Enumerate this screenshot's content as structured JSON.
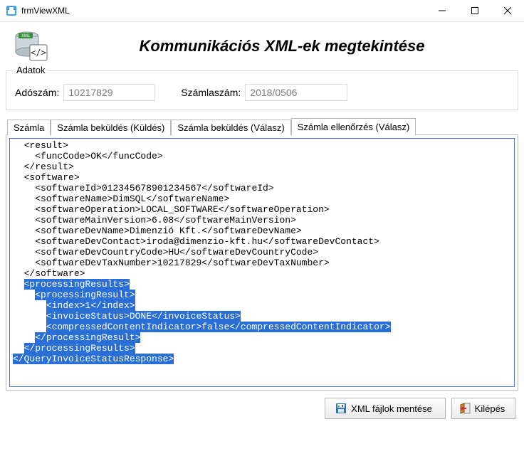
{
  "window": {
    "title": "frmViewXML"
  },
  "header": {
    "title": "Kommunikációs XML-ek megtekintése"
  },
  "adatok": {
    "legend": "Adatok",
    "tax_label": "Adószám:",
    "tax_value": "10217829",
    "invoice_label": "Számlaszám:",
    "invoice_value": "2018/0506"
  },
  "tabs": {
    "items": [
      {
        "label": "Számla"
      },
      {
        "label": "Számla beküldés (Küldés)"
      },
      {
        "label": "Számla beküldés (Válasz)"
      },
      {
        "label": "Számla ellenőrzés (Válasz)"
      }
    ],
    "active_index": 3
  },
  "xml": {
    "plain": "  <result>\n    <funcCode>OK</funcCode>\n  </result>\n  <software>\n    <softwareId>012345678901234567</softwareId>\n    <softwareName>DimSQL</softwareName>\n    <softwareOperation>LOCAL_SOFTWARE</softwareOperation>\n    <softwareMainVersion>6.08</softwareMainVersion>\n    <softwareDevName>Dimenzió Kft.</softwareDevName>\n    <softwareDevContact>iroda@dimenzio-kft.hu</softwareDevContact>\n    <softwareDevCountryCode>HU</softwareDevCountryCode>\n    <softwareDevTaxNumber>10217829</softwareDevTaxNumber>\n  </software>",
    "highlighted": [
      {
        "indent": "  ",
        "text": "<processingResults>"
      },
      {
        "indent": "    ",
        "text": "<processingResult>"
      },
      {
        "indent": "      ",
        "text": "<index>1</index>"
      },
      {
        "indent": "      ",
        "text": "<invoiceStatus>DONE</invoiceStatus>"
      },
      {
        "indent": "      ",
        "text": "<compressedContentIndicator>false</compressedContentIndicator>"
      },
      {
        "indent": "    ",
        "text": "</processingResult>"
      },
      {
        "indent": "  ",
        "text": "</processingResults>"
      },
      {
        "indent": "",
        "text": "</QueryInvoiceStatusResponse>"
      }
    ]
  },
  "footer": {
    "save_label": "XML fájlok mentése",
    "exit_label": "Kilépés"
  },
  "colors": {
    "highlight_bg": "#2a6fd6",
    "highlight_fg": "#ffffff",
    "panel_border": "#b9b9b9",
    "field_border": "#dcdcdc",
    "accent_border": "#4a7dc9"
  }
}
